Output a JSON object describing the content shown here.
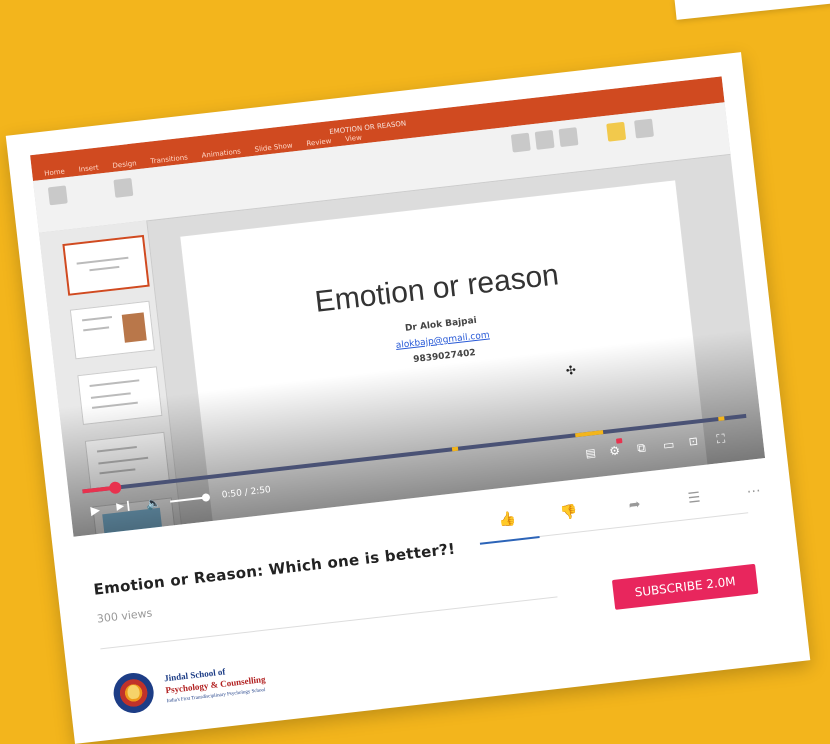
{
  "video": {
    "app_title": "EMOTION OR REASON",
    "ribbon_tabs": [
      "Home",
      "Insert",
      "Design",
      "Transitions",
      "Animations",
      "Slide Show",
      "Review",
      "View"
    ],
    "slide": {
      "title": "Emotion or reason",
      "author": "Dr Alok Bajpai",
      "email": "alokbajp@gmail.com",
      "phone": "9839027402"
    },
    "player": {
      "time": "0:50 / 2:50",
      "progress_fraction": 0.05
    }
  },
  "info": {
    "title": "Emotion or Reason: Which one is better?!",
    "views": "300 views",
    "subscribe_label": "SUBSCRIBE 2.0M"
  },
  "channel": {
    "line1": "Jindal School of",
    "line2": "Psychology & Counselling",
    "line3": "India's First Transdisciplinary Psychology School"
  },
  "colors": {
    "background": "#f3b51c",
    "accent_red": "#e8324e",
    "subscribe": "#e8265d",
    "like_blue": "#2c64b8",
    "ribbon": "#d04a20"
  },
  "icons": {
    "like": "thumbs-up-icon",
    "dislike": "thumbs-down-icon",
    "share": "share-icon",
    "save": "add-to-playlist-icon",
    "more": "more-icon"
  }
}
